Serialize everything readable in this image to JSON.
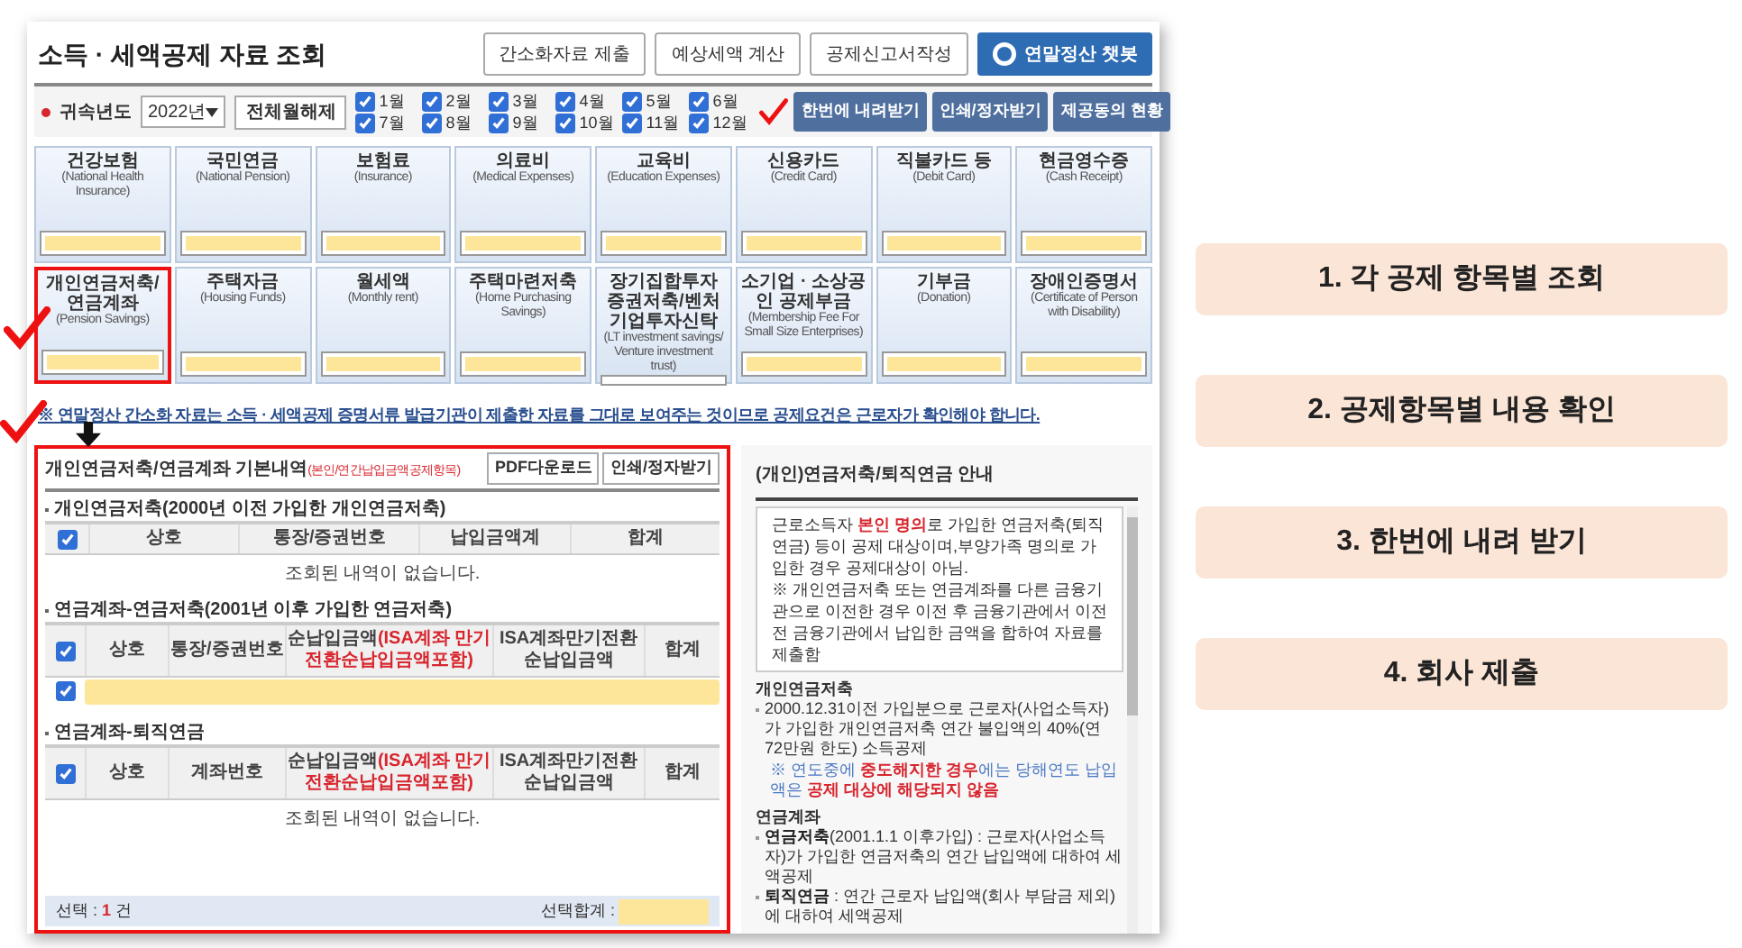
{
  "page_title": "소득 · 세액공제 자료 조회",
  "header_buttons": [
    {
      "label": "간소화자료 제출",
      "kind": "plain"
    },
    {
      "label": "예상세액 계산",
      "kind": "plain"
    },
    {
      "label": "공제신고서작성",
      "kind": "plain"
    },
    {
      "label": "연말정산 챗봇",
      "kind": "chatbot"
    }
  ],
  "year": {
    "label": "귀속년도",
    "value": "2022년",
    "required": true
  },
  "toggle_all_button": "전체월해제",
  "months": [
    {
      "label": "1월",
      "checked": true
    },
    {
      "label": "7월",
      "checked": true
    },
    {
      "label": "2월",
      "checked": true
    },
    {
      "label": "8월",
      "checked": true
    },
    {
      "label": "3월",
      "checked": true
    },
    {
      "label": "9월",
      "checked": true
    },
    {
      "label": "4월",
      "checked": true
    },
    {
      "label": "10월",
      "checked": true
    },
    {
      "label": "5월",
      "checked": true
    },
    {
      "label": "11월",
      "checked": true
    },
    {
      "label": "6월",
      "checked": true
    },
    {
      "label": "12월",
      "checked": true
    }
  ],
  "action_buttons": [
    "한번에 내려받기",
    "인쇄/정자받기",
    "제공동의 현황"
  ],
  "categories": [
    {
      "name": "건강보험",
      "english": "(National Health Insurance)",
      "selected": false
    },
    {
      "name": "국민연금",
      "english": "(National Pension)",
      "selected": false
    },
    {
      "name": "보험료",
      "english": "(Insurance)",
      "selected": false
    },
    {
      "name": "의료비",
      "english": "(Medical Expenses)",
      "selected": false
    },
    {
      "name": "교육비",
      "english": "(Education Expenses)",
      "selected": false
    },
    {
      "name": "신용카드",
      "english": "(Credit Card)",
      "selected": false
    },
    {
      "name": "직불카드 등",
      "english": "(Debit Card)",
      "selected": false
    },
    {
      "name": "현금영수증",
      "english": "(Cash Receipt)",
      "selected": false
    },
    {
      "name": "개인연금저축/연금계좌",
      "english": "(Pension Savings)",
      "selected": true
    },
    {
      "name": "주택자금",
      "english": "(Housing Funds)",
      "selected": false
    },
    {
      "name": "월세액",
      "english": "(Monthly rent)",
      "selected": false
    },
    {
      "name": "주택마련저축",
      "english": "(Home Purchasing Savings)",
      "selected": false
    },
    {
      "name": "장기집합투자증권저축/벤처기업투자신탁",
      "english": "(LT investment savings/ Venture investment trust)",
      "selected": false
    },
    {
      "name": "소기업 · 소상공인 공제부금",
      "english": "(Membership Fee For Small Size Enterprises)",
      "selected": false
    },
    {
      "name": "기부금",
      "english": "(Donation)",
      "selected": false
    },
    {
      "name": "장애인증명서",
      "english": "(Certificate of Person with Disability)",
      "selected": false
    }
  ],
  "notice": "※ 연말정산 간소화 자료는 소득 · 세액공제 증명서류 발급기관이 제출한 자료를 그대로 보여주는 것이므로 공제요건은 근로자가 확인해야 합니다.",
  "detail": {
    "title": "개인연금저축/연금계좌 기본내역",
    "subtitle": "(본인/연간납입금액공제항목)",
    "highlighted": true,
    "buttons": [
      "PDF다운로드",
      "인쇄/정자받기"
    ],
    "sections": [
      {
        "title": "개인연금저축(2000년 이전 가입한 개인연금저축)",
        "header_checked": true,
        "columns": [
          {
            "label": "상호"
          },
          {
            "label": "통장/증권번호"
          },
          {
            "label": "납입금액계"
          },
          {
            "label": "합계"
          }
        ],
        "empty_message": "조회된 내역이 없습니다."
      },
      {
        "title": "연금계좌-연금저축(2001년 이후 가입한 연금저축)",
        "header_checked": true,
        "columns": [
          {
            "label": "상호"
          },
          {
            "label": "통장/증권번호"
          },
          {
            "label": "순납입금액",
            "note": "(ISA계좌 만기전환순납입금액포함)"
          },
          {
            "label": "ISA계좌만기전환 순납입금액"
          },
          {
            "label": "합계"
          }
        ],
        "rows": [
          {
            "checked": true
          }
        ]
      },
      {
        "title": "연금계좌-퇴직연금",
        "header_checked": true,
        "columns": [
          {
            "label": "상호"
          },
          {
            "label": "계좌번호"
          },
          {
            "label": "순납입금액",
            "note": "(ISA계좌 만기전환순납입금액포함)"
          },
          {
            "label": "ISA계좌만기전환 순납입금액"
          },
          {
            "label": "합계"
          }
        ],
        "empty_message": "조회된 내역이 없습니다."
      }
    ],
    "footer": {
      "selected_label": "선택 :",
      "selected_count": "1",
      "count_unit": "건",
      "total_label": "선택합계 :"
    }
  },
  "guide": {
    "title": "(개인)연금저축/퇴직연금 안내",
    "box": [
      [
        {
          "text": "근로소득자 ",
          "kind": "plain"
        },
        {
          "text": "본인 명의",
          "kind": "warning"
        },
        {
          "text": "로 가입한 연금저축(퇴직연금) 등이 공제 대상이며,부양가족 명의로 가입한 경우 공제대상이 아님.",
          "kind": "plain"
        }
      ],
      [
        {
          "text": "※ 개인연금저축 또는 연금계좌를 다른 금융기관으로 이전한 경우 이전 후 금융기관에서 이전 전 금융기관에서 납입한 금액을 합하여 자료를 제출함",
          "kind": "plain"
        }
      ]
    ],
    "sections": [
      {
        "heading": "개인연금저축",
        "items": [
          {
            "kind": "bullet",
            "segments": [
              {
                "text": "2000.12.31이전 가입분으로 근로자(사업소득자)가 가입한 개인연금저축 연간 불입액의 40%(연 72만원 한도) 소득공제",
                "kind": "plain"
              }
            ]
          },
          {
            "kind": "note",
            "segments": [
              {
                "text": "※ 연도중에 ",
                "kind": "info"
              },
              {
                "text": "중도해지한 경우",
                "kind": "warning"
              },
              {
                "text": "에는 당해연도 납입액은 ",
                "kind": "info"
              },
              {
                "text": "공제 대상에 해당되지 않음",
                "kind": "warning"
              }
            ]
          }
        ]
      },
      {
        "heading": "연금계좌",
        "items": [
          {
            "kind": "bullet",
            "segments": [
              {
                "text": "연금저축",
                "kind": "term"
              },
              {
                "text": "(2001.1.1 이후가입) : 근로자(사업소득자)가 가입한 연금저축의 연간 납입액에 대하여 세액공제",
                "kind": "plain"
              }
            ]
          },
          {
            "kind": "bullet",
            "segments": [
              {
                "text": "퇴직연금",
                "kind": "term"
              },
              {
                "text": " : 연간 근로자 납입액(회사 부담금 제외)에 대하여 세액공제",
                "kind": "plain"
              }
            ]
          }
        ]
      }
    ]
  },
  "steps": [
    "1. 각 공제 항목별 조회",
    "2. 공제항목별 내용 확인",
    "3. 한번에 내려 받기",
    "4. 회사 제출"
  ]
}
